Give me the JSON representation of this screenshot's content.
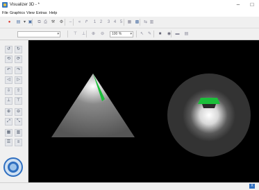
{
  "window": {
    "title": "Visualizer 3D - *",
    "minimize": "–",
    "maximize": "□"
  },
  "menu": [
    "File",
    "Graphics",
    "View",
    "Extras",
    "Help"
  ],
  "toolbar1": {
    "items": [
      {
        "name": "stop-icon",
        "glyph": "●",
        "color": "#d93025"
      },
      {
        "name": "open-icon",
        "glyph": "▤",
        "color": "#4a6fa5"
      },
      {
        "name": "dropdown-arrow-icon",
        "glyph": "▾",
        "color": "#555"
      },
      {
        "name": "save-icon",
        "glyph": "▣",
        "color": "#4a6fa5"
      },
      {
        "name": "copy-icon",
        "glyph": "⧉",
        "color": "#889"
      },
      {
        "name": "print-icon",
        "glyph": "⎙",
        "color": "#889"
      },
      {
        "name": "tools-icon",
        "glyph": "⚒",
        "color": "#555"
      },
      {
        "name": "settings-icon",
        "glyph": "⚙",
        "color": "#555"
      },
      {
        "name": "minus-icon",
        "glyph": "–",
        "color": "#889"
      },
      {
        "name": "shrink-icon",
        "glyph": "«",
        "color": "#889"
      },
      {
        "name": "expand-icon",
        "glyph": "↱",
        "color": "#889"
      },
      {
        "name": "view-1-icon",
        "glyph": "1",
        "color": "#889"
      },
      {
        "name": "view-2-icon",
        "glyph": "2",
        "color": "#889"
      },
      {
        "name": "view-3-icon",
        "glyph": "3",
        "color": "#889"
      },
      {
        "name": "view-4-icon",
        "glyph": "4",
        "color": "#889"
      },
      {
        "name": "view-5-icon",
        "glyph": "5",
        "color": "#889"
      },
      {
        "name": "grid-icon",
        "glyph": "▦",
        "color": "#889"
      },
      {
        "name": "image-icon",
        "glyph": "▩",
        "color": "#4a6fa5"
      },
      {
        "name": "transfer-icon",
        "glyph": "⇆",
        "color": "#889"
      },
      {
        "name": "table-icon",
        "glyph": "▥",
        "color": "#889"
      }
    ]
  },
  "toolbar2": {
    "combo_value": "",
    "zoom_value": "100 %",
    "items": [
      {
        "name": "align-top-icon",
        "glyph": "⊤",
        "color": "#889"
      },
      {
        "name": "align-bottom-icon",
        "glyph": "⊥",
        "color": "#889"
      },
      {
        "name": "zoom-in-icon",
        "glyph": "⊕",
        "color": "#889"
      },
      {
        "name": "zoom-out-icon",
        "glyph": "⊖",
        "color": "#889"
      },
      {
        "name": "pointer-icon",
        "glyph": "↖",
        "color": "#889"
      },
      {
        "name": "brush-icon",
        "glyph": "✎",
        "color": "#889"
      },
      {
        "name": "block-icon",
        "glyph": "■",
        "color": "#667"
      },
      {
        "name": "eye-icon",
        "glyph": "◉",
        "color": "#667"
      },
      {
        "name": "line-icon",
        "glyph": "▬",
        "color": "#889"
      },
      {
        "name": "list-icon",
        "glyph": "▤",
        "color": "#889"
      }
    ]
  },
  "sidebar_buttons": [
    {
      "name": "rotate-ccw-icon",
      "glyph": "↺"
    },
    {
      "name": "rotate-cw-icon",
      "glyph": "↻"
    },
    {
      "name": "rotate-x-icon",
      "glyph": "⟲"
    },
    {
      "name": "rotate-y-icon",
      "glyph": "⟳"
    },
    {
      "name": "turn-left-icon",
      "glyph": "↶"
    },
    {
      "name": "turn-right-icon",
      "glyph": "↷"
    },
    {
      "name": "move-left-icon",
      "glyph": "◁"
    },
    {
      "name": "move-right-icon",
      "glyph": "▷"
    },
    {
      "name": "move-down-icon",
      "glyph": "⇩"
    },
    {
      "name": "move-up-icon",
      "glyph": "⇧"
    },
    {
      "name": "align-floor-icon",
      "glyph": "⊥"
    },
    {
      "name": "align-ceiling-icon",
      "glyph": "⊤"
    },
    {
      "name": "zoom-in-icon",
      "glyph": "⊕"
    },
    {
      "name": "zoom-out-icon",
      "glyph": "⊖"
    },
    {
      "name": "slope-up-icon",
      "glyph": "⤢"
    },
    {
      "name": "slope-down-icon",
      "glyph": "⤡"
    },
    {
      "name": "grid-a-icon",
      "glyph": "▦"
    },
    {
      "name": "grid-b-icon",
      "glyph": "▥"
    },
    {
      "name": "layers-a-icon",
      "glyph": "☰"
    },
    {
      "name": "layers-b-icon",
      "glyph": "≡"
    }
  ],
  "status": {
    "button_label": "X"
  },
  "colors": {
    "viewport": "#000000",
    "highlight": "#1bbf3a",
    "accent": "#2f6fc0",
    "stop": "#d93025"
  }
}
